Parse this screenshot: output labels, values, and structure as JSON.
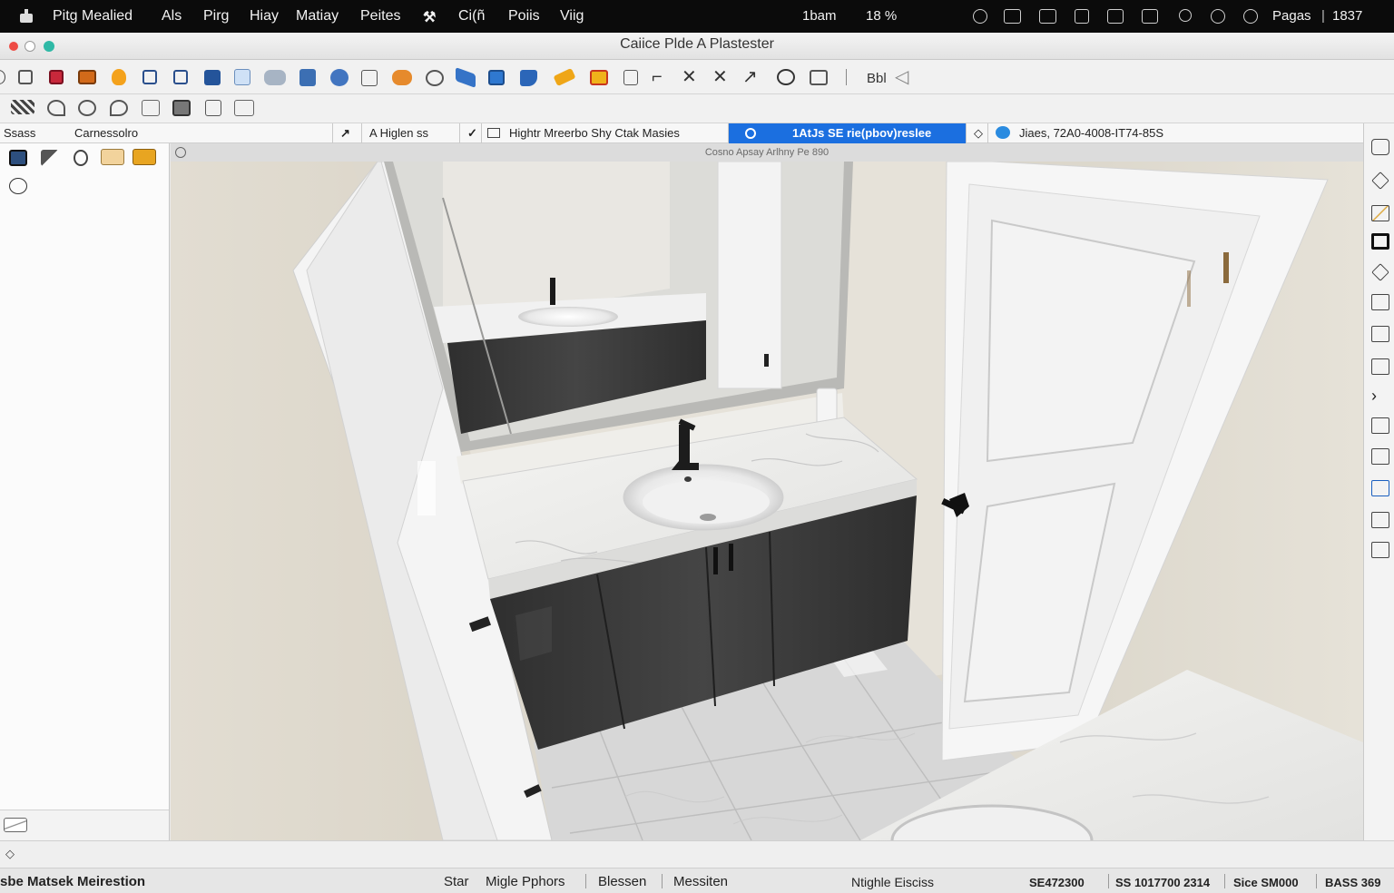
{
  "menubar": {
    "items": [
      "Pitg Mealied",
      "Als",
      "Pirg",
      "Hiay",
      "Matiay",
      "Peites",
      "Ci(ñ",
      "Poiis",
      "Viig"
    ],
    "status": [
      "1bam",
      "18 %",
      "Pagas",
      "1837"
    ]
  },
  "window": {
    "title": "Caiice Plde A Plastester"
  },
  "toolbar": {
    "text": "Bbl"
  },
  "tabs": {
    "left": "Ssass",
    "caption": "Carnessolro",
    "mode": "A Higlen ss",
    "materials": "Hightr Mreerbo Shy Ctak Masies",
    "active": "1AtJs SE rie(pbov)reslee",
    "info": "Jiaes, 72A0-4008-IT74-85S"
  },
  "viewport": {
    "caption": "Cosno Apsay Arlhny Pe 890"
  },
  "status_bar": {
    "left": "sbe Matsek Meirestion",
    "mode": "Star",
    "profile": "Migle Pphors",
    "item1": "Blessen",
    "item2": "Messiten",
    "center": "Ntighle Eisciss",
    "coord1": "SE472300",
    "coord2": "SS 1017700 2314",
    "size": "Sice SM000",
    "bass": "BASS 369"
  },
  "colors": {
    "accent": "#1b6fe0",
    "menubar": "#0b0b0b",
    "cabinet": "#3a3a3a"
  },
  "icons": {
    "toolbar1": [
      "circle-icon",
      "page-icon",
      "red-box-icon",
      "image-icon",
      "bulb-icon",
      "window-icon",
      "panel-icon",
      "cube-icon",
      "group-icon",
      "grid-icon",
      "link-icon",
      "sheet-icon",
      "paint-icon",
      "globe-icon",
      "ruler-icon",
      "monitor-icon",
      "folder-icon",
      "pen-icon",
      "stack-icon",
      "list-icon",
      "corner-icon",
      "cross-icon",
      "close-icon",
      "arrow-icon",
      "magnify-icon",
      "square-icon"
    ],
    "toolbar2": [
      "hatch-icon",
      "rotate-icon",
      "orbit-icon",
      "walk-icon",
      "section-icon",
      "camera-icon",
      "book-icon",
      "layers-icon"
    ]
  }
}
